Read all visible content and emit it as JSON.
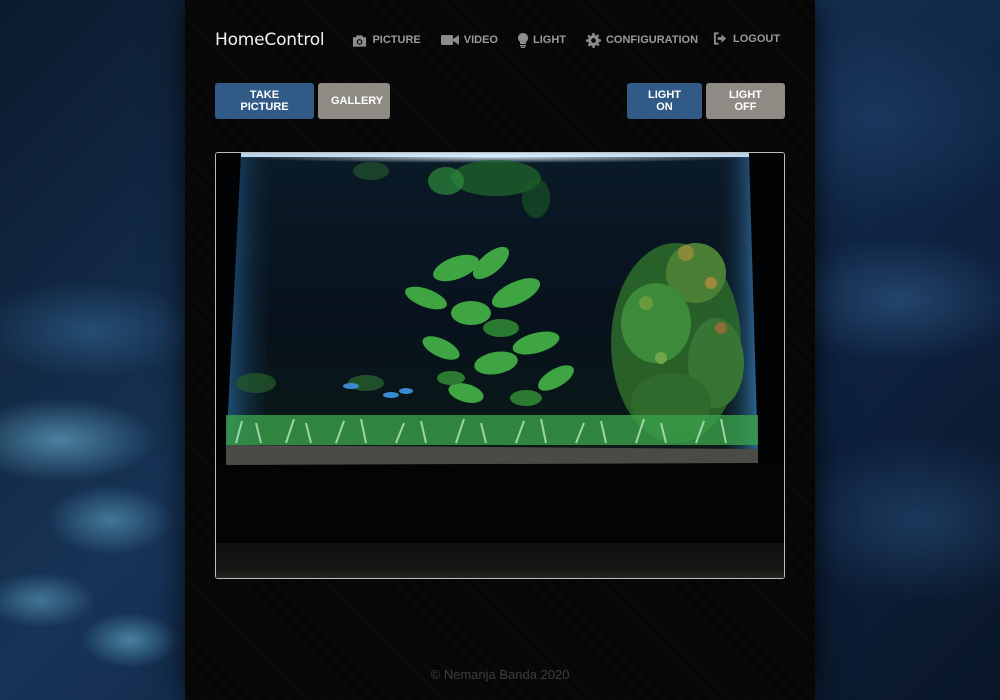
{
  "nav": {
    "brand": "HomeControl",
    "items": [
      {
        "label": "PICTURE",
        "icon": "camera-icon"
      },
      {
        "label": "VIDEO",
        "icon": "video-camera-icon"
      },
      {
        "label": "LIGHT",
        "icon": "lightbulb-icon"
      },
      {
        "label": "CONFIGURATION",
        "icon": "gear-icon"
      }
    ],
    "logout": {
      "label": "LOGOUT",
      "icon": "logout-icon"
    }
  },
  "actions": {
    "take_picture": "TAKE PICTURE",
    "gallery": "GALLERY",
    "light_on": "LIGHT ON",
    "light_off": "LIGHT OFF"
  },
  "colors": {
    "primary": "#325a87",
    "secondary": "#8e8b85",
    "panel": "#060607"
  },
  "footer": {
    "text": "© Nemanja Banda 2020"
  }
}
